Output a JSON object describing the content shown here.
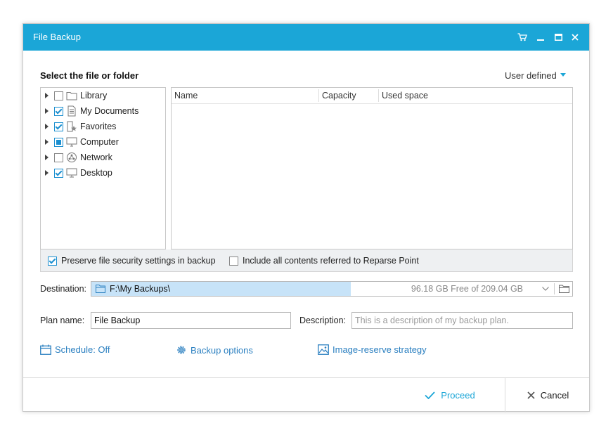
{
  "window": {
    "title": "File Backup",
    "accent_color": "#1ba6d7",
    "title_icons": [
      "cart-icon",
      "minimize-icon",
      "maximize-icon",
      "close-icon"
    ]
  },
  "source": {
    "section_title": "Select the file or folder",
    "view_mode": "User defined",
    "tree": [
      {
        "label": "Library",
        "state": "unchecked",
        "icon": "folder-icon"
      },
      {
        "label": "My Documents",
        "state": "checked",
        "icon": "document-icon"
      },
      {
        "label": "Favorites",
        "state": "checked",
        "icon": "favorites-icon"
      },
      {
        "label": "Computer",
        "state": "partial",
        "icon": "computer-icon"
      },
      {
        "label": "Network",
        "state": "unchecked",
        "icon": "network-icon"
      },
      {
        "label": "Desktop",
        "state": "checked",
        "icon": "desktop-icon"
      }
    ],
    "columns": [
      "Name",
      "Capacity",
      "Used space"
    ]
  },
  "options": {
    "preserve_security": {
      "label": "Preserve file security settings in backup",
      "checked": true
    },
    "reparse_point": {
      "label": "Include all contents referred to Reparse Point",
      "checked": false
    }
  },
  "destination": {
    "label": "Destination:",
    "path": "F:\\My Backups\\",
    "free_space": "96.18 GB Free of 209.04 GB",
    "used_fraction": 0.54
  },
  "plan": {
    "name_label": "Plan name:",
    "name_value": "File Backup",
    "description_label": "Description:",
    "description_placeholder": "This is a description of my backup plan."
  },
  "links": {
    "schedule": "Schedule: Off",
    "backup_options": "Backup options",
    "image_reserve": "Image-reserve strategy"
  },
  "footer": {
    "proceed": "Proceed",
    "cancel": "Cancel"
  }
}
